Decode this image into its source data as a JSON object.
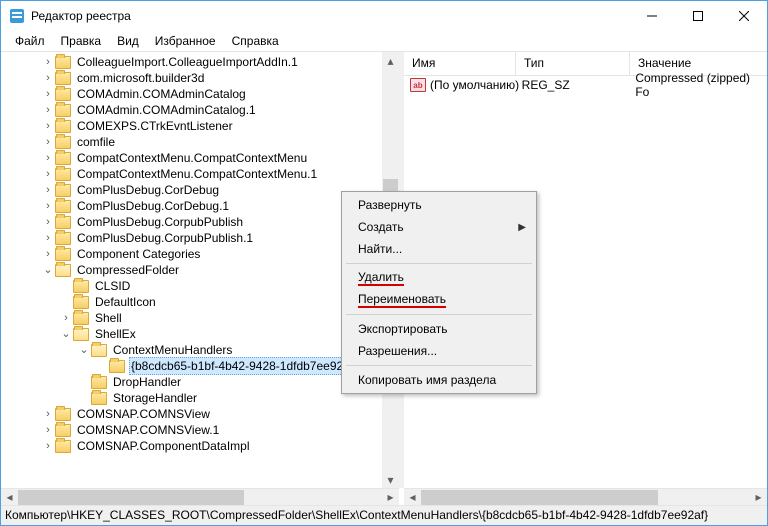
{
  "title": "Редактор реестра",
  "menubar": [
    "Файл",
    "Правка",
    "Вид",
    "Избранное",
    "Справка"
  ],
  "tree": [
    {
      "indent": 2,
      "tw": ">",
      "label": "ColleagueImport.ColleagueImportAddIn.1"
    },
    {
      "indent": 2,
      "tw": ">",
      "label": "com.microsoft.builder3d"
    },
    {
      "indent": 2,
      "tw": ">",
      "label": "COMAdmin.COMAdminCatalog"
    },
    {
      "indent": 2,
      "tw": ">",
      "label": "COMAdmin.COMAdminCatalog.1"
    },
    {
      "indent": 2,
      "tw": ">",
      "label": "COMEXPS.CTrkEvntListener"
    },
    {
      "indent": 2,
      "tw": ">",
      "label": "comfile"
    },
    {
      "indent": 2,
      "tw": ">",
      "label": "CompatContextMenu.CompatContextMenu"
    },
    {
      "indent": 2,
      "tw": ">",
      "label": "CompatContextMenu.CompatContextMenu.1"
    },
    {
      "indent": 2,
      "tw": ">",
      "label": "ComPlusDebug.CorDebug"
    },
    {
      "indent": 2,
      "tw": ">",
      "label": "ComPlusDebug.CorDebug.1"
    },
    {
      "indent": 2,
      "tw": ">",
      "label": "ComPlusDebug.CorpubPublish"
    },
    {
      "indent": 2,
      "tw": ">",
      "label": "ComPlusDebug.CorpubPublish.1"
    },
    {
      "indent": 2,
      "tw": ">",
      "label": "Component Categories"
    },
    {
      "indent": 2,
      "tw": "v",
      "label": "CompressedFolder",
      "open": true
    },
    {
      "indent": 3,
      "tw": "",
      "label": "CLSID"
    },
    {
      "indent": 3,
      "tw": "",
      "label": "DefaultIcon"
    },
    {
      "indent": 3,
      "tw": ">",
      "label": "Shell"
    },
    {
      "indent": 3,
      "tw": "v",
      "label": "ShellEx",
      "open": true
    },
    {
      "indent": 4,
      "tw": "v",
      "label": "ContextMenuHandlers",
      "open": true
    },
    {
      "indent": 5,
      "tw": "",
      "label": "{b8cdcb65-b1bf-4b42-9428-1dfdb7ee92af}",
      "selected": true,
      "underline": true
    },
    {
      "indent": 4,
      "tw": "",
      "label": "DropHandler"
    },
    {
      "indent": 4,
      "tw": "",
      "label": "StorageHandler"
    },
    {
      "indent": 2,
      "tw": ">",
      "label": "COMSNAP.COMNSView"
    },
    {
      "indent": 2,
      "tw": ">",
      "label": "COMSNAP.COMNSView.1"
    },
    {
      "indent": 2,
      "tw": ">",
      "label": "COMSNAP.ComponentDataImpl"
    }
  ],
  "columns": {
    "name": "Имя",
    "type": "Тип",
    "data": "Значение"
  },
  "values": [
    {
      "name": "(По умолчанию)",
      "type": "REG_SZ",
      "data": "Compressed (zipped) Fo"
    }
  ],
  "context_menu": [
    {
      "label": "Развернуть"
    },
    {
      "label": "Создать",
      "sub": true
    },
    {
      "label": "Найти..."
    },
    {
      "sep": true
    },
    {
      "label": "Удалить",
      "underline": true
    },
    {
      "label": "Переименовать",
      "underline": true
    },
    {
      "sep": true
    },
    {
      "label": "Экспортировать"
    },
    {
      "label": "Разрешения..."
    },
    {
      "sep": true
    },
    {
      "label": "Копировать имя раздела"
    }
  ],
  "statusbar": "Компьютер\\HKEY_CLASSES_ROOT\\CompressedFolder\\ShellEx\\ContextMenuHandlers\\{b8cdcb65-b1bf-4b42-9428-1dfdb7ee92af}"
}
